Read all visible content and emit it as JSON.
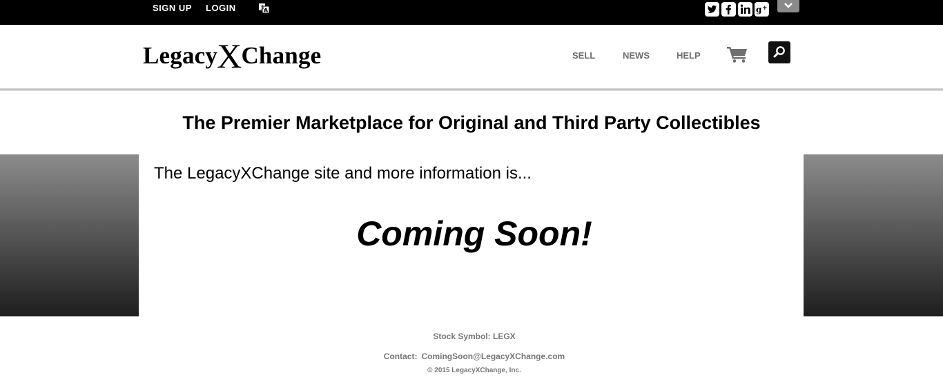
{
  "topbar": {
    "signup_label": "SIGN UP",
    "login_label": "LOGIN",
    "icons": [
      "translate-icon",
      "twitter-icon",
      "facebook-icon",
      "linkedin-icon",
      "google-plus-icon",
      "chevron-down-icon"
    ]
  },
  "header": {
    "logo": {
      "before": "Legacy",
      "x": "X",
      "after": "Change"
    },
    "nav": {
      "sell": "SELL",
      "news": "NEWS",
      "help": "HELP"
    },
    "icons": [
      "cart-icon",
      "search-icon"
    ]
  },
  "main": {
    "headline": "The Premier Marketplace for Original and Third Party Collectibles",
    "intro": "The LegacyXChange site and more information is...",
    "coming_soon": "Coming Soon!"
  },
  "footer": {
    "stock": "Stock Symbol: LEGX",
    "contact_label": "Contact:",
    "contact_email": "ComingSoon@LegacyXChange.com",
    "copyright": "© 2015 LegacyXChange, Inc."
  },
  "colors": {
    "topbar_bg": "#000000",
    "nav_text": "#6b6b6b",
    "footer_text": "#777777",
    "side_gradient_top": "#8c8c8c",
    "side_gradient_bottom": "#1e1e1e"
  }
}
